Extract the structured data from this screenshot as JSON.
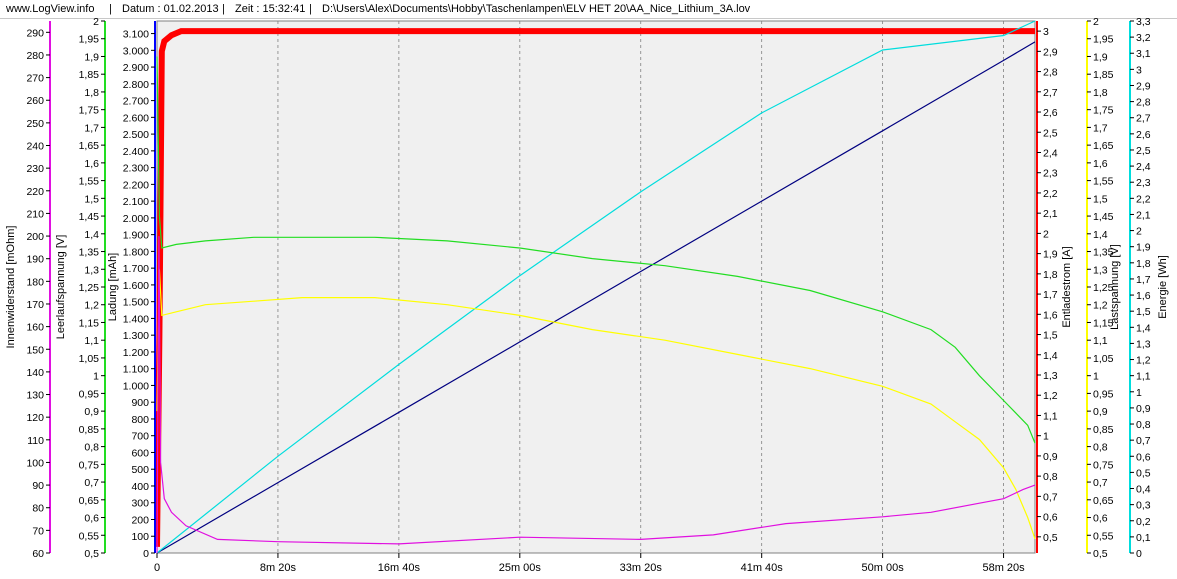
{
  "header": {
    "site": "www.LogView.info",
    "sep": "|",
    "date_label": "Datum : 01.02.2013",
    "time_label": "Zeit : 15:32:41",
    "path": "D:\\Users\\Alex\\Documents\\Hobby\\Taschenlampen\\ELV HET 20\\AA_Nice_Lithium_3A.lov"
  },
  "colors": {
    "innenwiderstand": "#e010e0",
    "leerlaufspannung": "#22dd22",
    "ladung": "#000080",
    "entladestrom": "#ff0000",
    "lastspannung": "#ffff00",
    "energie": "#00dddd",
    "plot_bg": "#f0f0f0",
    "grid": "#808080"
  },
  "chart_data": {
    "type": "line",
    "x_unit": "s",
    "x_ticks": [
      "0",
      "8m 20s",
      "16m 40s",
      "25m 00s",
      "33m 20s",
      "41m 40s",
      "50m 00s",
      "58m 20s"
    ],
    "x_tick_values": [
      0,
      500,
      1000,
      1500,
      2000,
      2500,
      3000,
      3500
    ],
    "x_range": [
      0,
      3630
    ],
    "grid": "vertical dashed",
    "axes": {
      "innenwiderstand": {
        "label": "Innenwiderstand [mOhm]",
        "side": "left",
        "range": [
          60,
          295
        ],
        "ticks": [
          "290",
          "280",
          "270",
          "260",
          "250",
          "240",
          "230",
          "220",
          "210",
          "200",
          "190",
          "180",
          "170",
          "160",
          "150",
          "140",
          "130",
          "120",
          "110",
          "100",
          "90",
          "80",
          "70",
          "60"
        ]
      },
      "leerlaufspannung": {
        "label": "Leerlaufspannung [V]",
        "side": "left",
        "range": [
          0.5,
          2.0
        ],
        "ticks": [
          "2",
          "1,95",
          "1,9",
          "1,85",
          "1,8",
          "1,75",
          "1,7",
          "1,65",
          "1,6",
          "1,55",
          "1,5",
          "1,45",
          "1,4",
          "1,35",
          "1,3",
          "1,25",
          "1,2",
          "1,15",
          "1,1",
          "1,05",
          "1",
          "0,95",
          "0,9",
          "0,85",
          "0,8",
          "0,75",
          "0,7",
          "0,65",
          "0,6",
          "0,55",
          "0,5"
        ]
      },
      "ladung": {
        "label": "Ladung [mAh]",
        "side": "left",
        "range": [
          0,
          3175
        ],
        "ticks": [
          "3.100",
          "3.000",
          "2.900",
          "2.800",
          "2.700",
          "2.600",
          "2.500",
          "2.400",
          "2.300",
          "2.200",
          "2.100",
          "2.000",
          "1.900",
          "1.800",
          "1.700",
          "1.600",
          "1.500",
          "1.400",
          "1.300",
          "1.200",
          "1.100",
          "1.000",
          "900",
          "800",
          "700",
          "600",
          "500",
          "400",
          "300",
          "200",
          "100",
          "0"
        ]
      },
      "entladestrom": {
        "label": "Entladestrom [A]",
        "side": "right",
        "range": [
          0.42,
          3.05
        ],
        "ticks": [
          "3",
          "2,9",
          "2,8",
          "2,7",
          "2,6",
          "2,5",
          "2,4",
          "2,3",
          "2,2",
          "2,1",
          "2",
          "1,9",
          "1,8",
          "1,7",
          "1,6",
          "1,5",
          "1,4",
          "1,3",
          "1,2",
          "1,1",
          "1",
          "0,9",
          "0,8",
          "0,7",
          "0,6",
          "0,5"
        ]
      },
      "lastspannung": {
        "label": "Lastspannung [V]",
        "side": "right",
        "range": [
          0.5,
          2.0
        ],
        "ticks": [
          "2",
          "1,95",
          "1,9",
          "1,85",
          "1,8",
          "1,75",
          "1,7",
          "1,65",
          "1,6",
          "1,55",
          "1,5",
          "1,45",
          "1,4",
          "1,35",
          "1,3",
          "1,25",
          "1,2",
          "1,15",
          "1,1",
          "1,05",
          "1",
          "0,95",
          "0,9",
          "0,85",
          "0,8",
          "0,75",
          "0,7",
          "0,65",
          "0,6",
          "0,55",
          "0,5"
        ]
      },
      "energie": {
        "label": "Energie [Wh]",
        "side": "right",
        "range": [
          0,
          3.3
        ],
        "ticks": [
          "3,3",
          "3,2",
          "3,1",
          "3",
          "2,9",
          "2,8",
          "2,7",
          "2,6",
          "2,5",
          "2,4",
          "2,3",
          "2,2",
          "2,1",
          "2",
          "1,9",
          "1,8",
          "1,7",
          "1,6",
          "1,5",
          "1,4",
          "1,3",
          "1,2",
          "1,1",
          "1",
          "0,9",
          "0,8",
          "0,7",
          "0,6",
          "0,5",
          "0,4",
          "0,3",
          "0,2",
          "0,1",
          "0"
        ]
      }
    },
    "series": [
      {
        "axis": "entladestrom",
        "x": [
          0,
          10,
          20,
          30,
          60,
          100,
          3630
        ],
        "y": [
          0.45,
          1.5,
          2.9,
          2.95,
          2.98,
          3.0,
          3.0
        ]
      },
      {
        "axis": "ladung",
        "x": [
          0,
          500,
          1000,
          1500,
          2000,
          2500,
          3000,
          3500,
          3630
        ],
        "y": [
          0,
          420,
          840,
          1260,
          1680,
          2100,
          2520,
          2940,
          3050
        ]
      },
      {
        "axis": "energie",
        "x": [
          0,
          500,
          1000,
          1500,
          2000,
          2500,
          3000,
          3500,
          3630
        ],
        "y": [
          0,
          0.6,
          1.17,
          1.72,
          2.24,
          2.73,
          3.12,
          3.21,
          3.3
        ]
      },
      {
        "axis": "leerlaufspannung",
        "x": [
          0,
          10,
          20,
          80,
          200,
          400,
          600,
          900,
          1200,
          1500,
          1800,
          2100,
          2400,
          2700,
          3000,
          3200,
          3300,
          3400,
          3500,
          3600,
          3630
        ],
        "y": [
          1.9,
          1.45,
          1.36,
          1.37,
          1.38,
          1.39,
          1.39,
          1.39,
          1.38,
          1.36,
          1.33,
          1.31,
          1.28,
          1.24,
          1.18,
          1.13,
          1.08,
          1.0,
          0.93,
          0.86,
          0.81
        ]
      },
      {
        "axis": "lastspannung",
        "x": [
          0,
          10,
          20,
          80,
          200,
          400,
          600,
          900,
          1200,
          1500,
          1800,
          2100,
          2400,
          2700,
          3000,
          3200,
          3300,
          3400,
          3500,
          3550,
          3600,
          3630
        ],
        "y": [
          0.9,
          1.3,
          1.17,
          1.18,
          1.2,
          1.21,
          1.22,
          1.22,
          1.2,
          1.17,
          1.13,
          1.1,
          1.06,
          1.02,
          0.97,
          0.92,
          0.87,
          0.82,
          0.74,
          0.68,
          0.6,
          0.54
        ]
      },
      {
        "axis": "innenwiderstand",
        "x": [
          0,
          8,
          15,
          30,
          60,
          120,
          250,
          500,
          1000,
          1500,
          2000,
          2300,
          2600,
          3000,
          3200,
          3400,
          3500,
          3580,
          3630
        ],
        "y": [
          60,
          200,
          100,
          84,
          78,
          72,
          66,
          65,
          64,
          67,
          66,
          68,
          73,
          76,
          78,
          82,
          84,
          88,
          90
        ]
      }
    ]
  }
}
